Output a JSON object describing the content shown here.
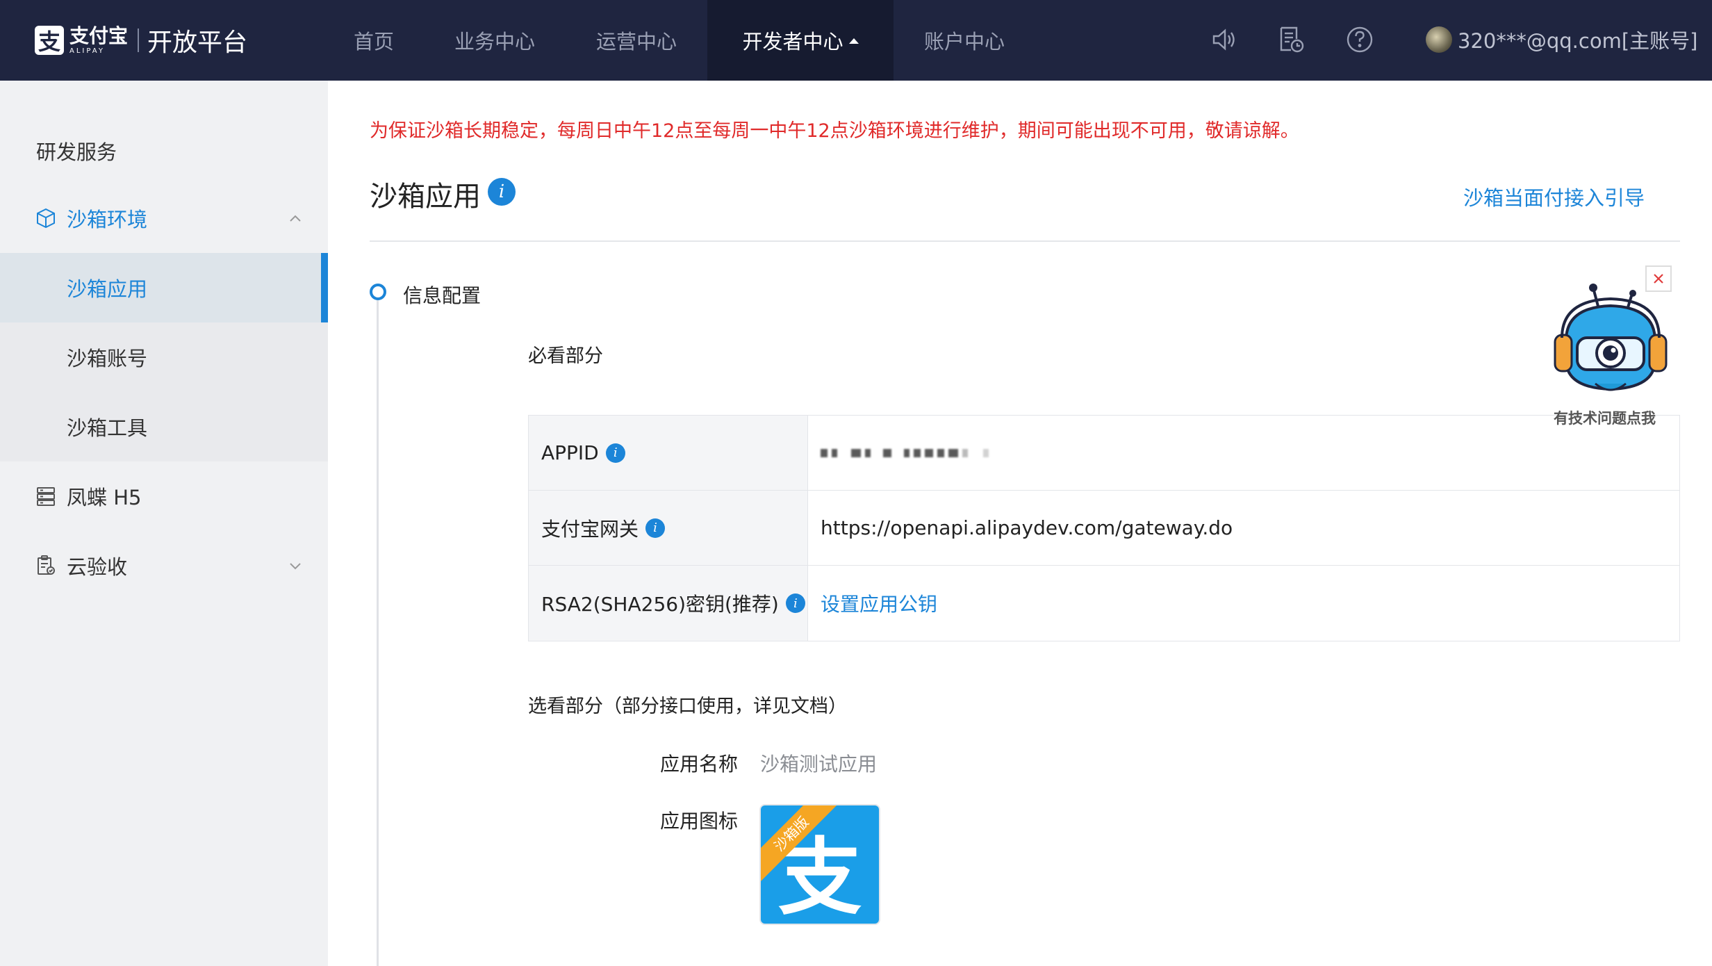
{
  "brand": {
    "logo_glyph": "支",
    "logo_cn": "支付宝",
    "logo_en": "ALIPAY",
    "platform_title": "开放平台"
  },
  "nav": {
    "items": [
      {
        "label": "首页"
      },
      {
        "label": "业务中心"
      },
      {
        "label": "运营中心"
      },
      {
        "label": "开发者中心",
        "active": true
      },
      {
        "label": "账户中心"
      }
    ],
    "icons": [
      "speaker-icon",
      "document-clock-icon",
      "help-icon"
    ],
    "account": "320***@qq.com[主账号]"
  },
  "sidebar": {
    "heading": "研发服务",
    "groups": [
      {
        "label": "沙箱环境",
        "icon": "box-icon",
        "expanded": true,
        "children": [
          {
            "label": "沙箱应用",
            "active": true
          },
          {
            "label": "沙箱账号"
          },
          {
            "label": "沙箱工具"
          }
        ]
      },
      {
        "label": "凤蝶 H5",
        "icon": "server-icon"
      },
      {
        "label": "云验收",
        "icon": "clipboard-icon",
        "expanded": false
      }
    ]
  },
  "main": {
    "notice": "为保证沙箱长期稳定，每周日中午12点至每周一中午12点沙箱环境进行维护，期间可能出现不可用，敬请谅解。",
    "title": "沙箱应用",
    "info_glyph": "i",
    "guide_link": "沙箱当面付接入引导",
    "step_label": "信息配置",
    "required_title": "必看部分",
    "config": [
      {
        "key": "APPID",
        "value": "",
        "masked": true
      },
      {
        "key": "支付宝网关",
        "value": "https://openapi.alipaydev.com/gateway.do"
      },
      {
        "key": "RSA2(SHA256)密钥(推荐)",
        "value": "设置应用公钥",
        "link": true
      }
    ],
    "optional_title": "选看部分（部分接口使用，详见文档）",
    "app_name_label": "应用名称",
    "app_name_value": "沙箱测试应用",
    "app_icon_label": "应用图标",
    "app_icon_glyph": "支",
    "app_icon_ribbon": "沙箱版"
  },
  "helper": {
    "caption": "有技术问题点我"
  },
  "colors": {
    "nav_bg": "#1f2540",
    "accent": "#1c85d8",
    "notice": "#e02a2a",
    "sidebar_bg": "#f0f1f3"
  }
}
